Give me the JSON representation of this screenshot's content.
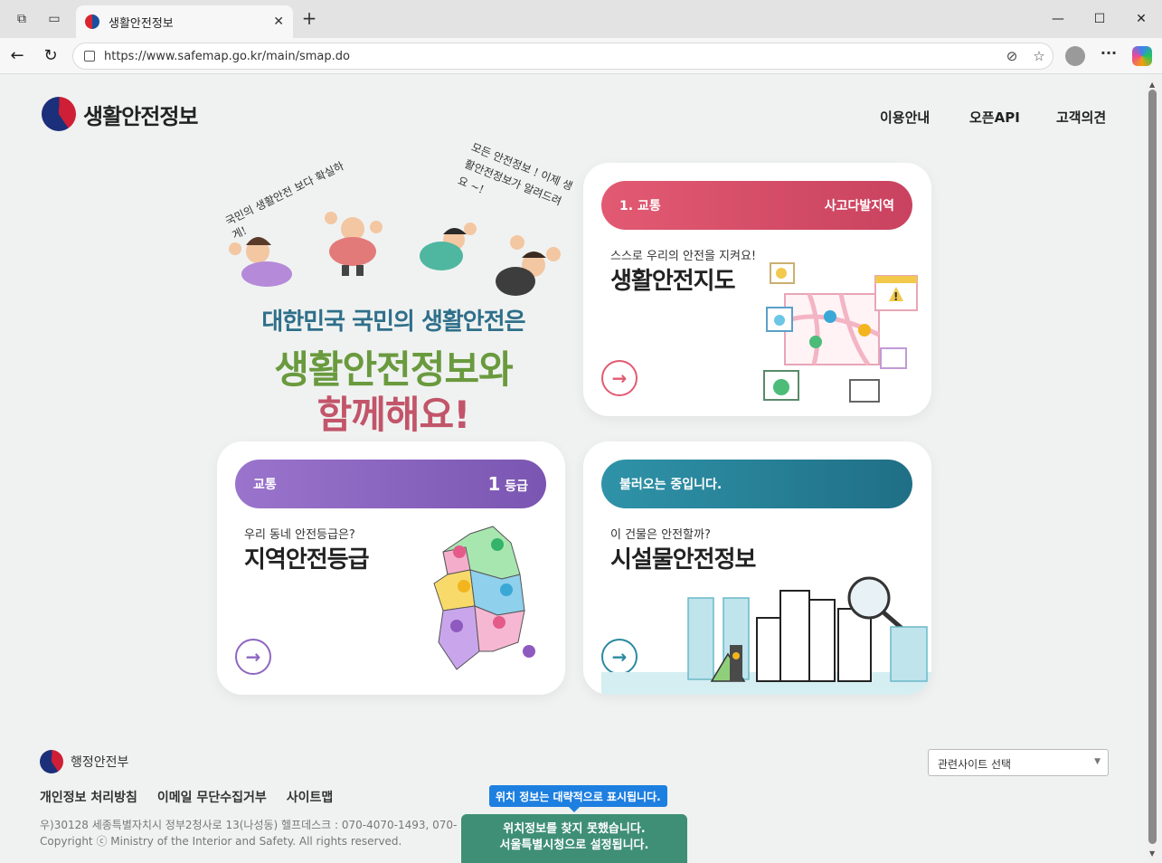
{
  "browser": {
    "tab_title": "생활안전정보",
    "url": "https://www.safemap.go.kr/main/smap.do"
  },
  "site": {
    "logo_text": "생활안전정보",
    "nav": [
      "이용안내",
      "오픈API",
      "고객의견"
    ]
  },
  "hero": {
    "handwriting_1": "국민의 생활안전 보다 확실하게!",
    "handwriting_2": "모든 안전정보 ! 이제 생활안전정보가 알려드려요 ~!",
    "line1": "대한민국 국민의 생활안전은",
    "line2": "생활안전정보와",
    "line3": "함께해요!"
  },
  "cards": {
    "map": {
      "pill_left": "1. 교통",
      "pill_right": "사고다발지역",
      "subtitle": "스스로 우리의 안전을 지켜요!",
      "title": "생활안전지도",
      "color": "#e0566f"
    },
    "grade": {
      "pill_left": "교통",
      "pill_right_num": "1",
      "pill_right_unit": "등급",
      "subtitle": "우리 동네 안전등급은?",
      "title": "지역안전등급",
      "color": "#8e66c0"
    },
    "facility": {
      "pill_left": "불러오는 중입니다.",
      "subtitle": "이 건물은 안전할까?",
      "title": "시설물안전정보",
      "color": "#2a8aa0"
    }
  },
  "footer": {
    "ministry": "행정안전부",
    "links": [
      "개인정보 처리방침",
      "이메일 무단수집거부",
      "사이트맵"
    ],
    "address": "우)30128 세종특별자치시 정부2청사로 13(나성동) 헬프데스크 : 070-4070-1493, 070-",
    "copyright": "Copyright ⓒ Ministry of the Interior and Safety. All rights reserved.",
    "related_select": "관련사이트 선택"
  },
  "location": {
    "tooltip": "위치 정보는 대략적으로 표시됩니다.",
    "toast_line1": "위치정보를 찾지 못했습니다.",
    "toast_line2": "서울특별시청으로 설정됩니다."
  }
}
